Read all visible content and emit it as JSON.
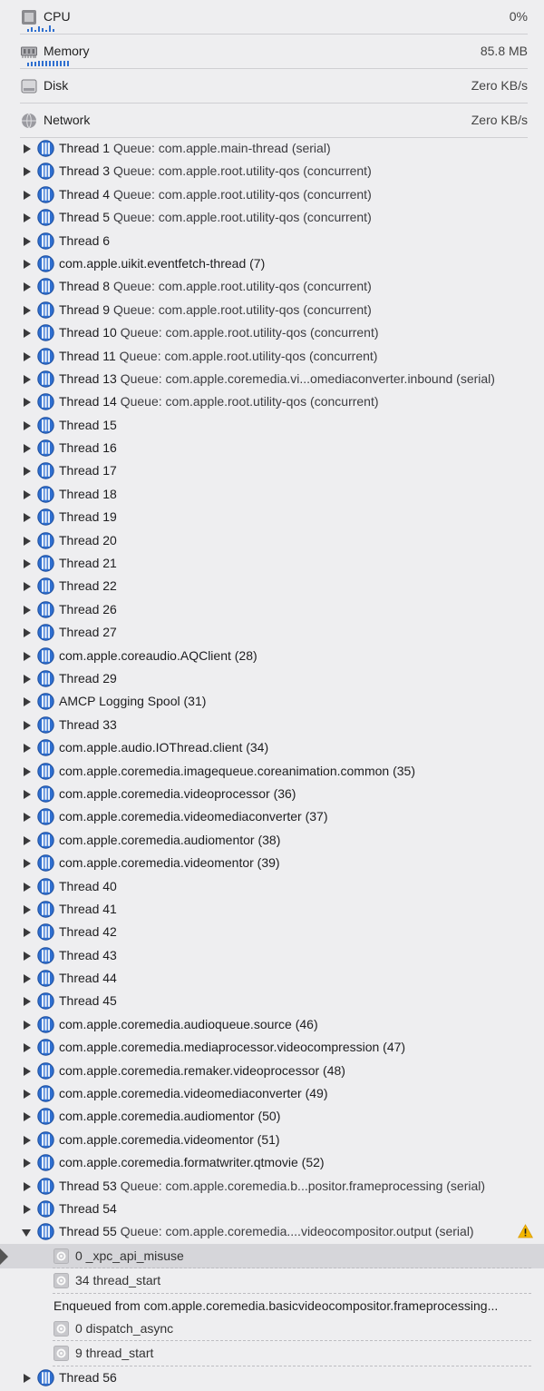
{
  "gauges": [
    {
      "label": "CPU",
      "value": "0%",
      "icon": "cpu-icon"
    },
    {
      "label": "Memory",
      "value": "85.8 MB",
      "icon": "memory-icon"
    },
    {
      "label": "Disk",
      "value": "Zero KB/s",
      "icon": "disk-icon"
    },
    {
      "label": "Network",
      "value": "Zero KB/s",
      "icon": "network-icon"
    }
  ],
  "threads_before": [
    {
      "name": "Thread 1",
      "queue": "Queue: com.apple.main-thread (serial)"
    },
    {
      "name": "Thread 3",
      "queue": "Queue: com.apple.root.utility-qos (concurrent)"
    },
    {
      "name": "Thread 4",
      "queue": "Queue: com.apple.root.utility-qos (concurrent)"
    },
    {
      "name": "Thread 5",
      "queue": "Queue: com.apple.root.utility-qos (concurrent)"
    },
    {
      "name": "Thread 6",
      "queue": ""
    },
    {
      "name": "com.apple.uikit.eventfetch-thread (7)",
      "queue": ""
    },
    {
      "name": "Thread 8",
      "queue": "Queue: com.apple.root.utility-qos (concurrent)"
    },
    {
      "name": "Thread 9",
      "queue": "Queue: com.apple.root.utility-qos (concurrent)"
    },
    {
      "name": "Thread 10",
      "queue": "Queue: com.apple.root.utility-qos (concurrent)"
    },
    {
      "name": "Thread 11",
      "queue": "Queue: com.apple.root.utility-qos (concurrent)"
    },
    {
      "name": "Thread 13",
      "queue": "Queue: com.apple.coremedia.vi...omediaconverter.inbound (serial)"
    },
    {
      "name": "Thread 14",
      "queue": "Queue: com.apple.root.utility-qos (concurrent)"
    },
    {
      "name": "Thread 15",
      "queue": ""
    },
    {
      "name": "Thread 16",
      "queue": ""
    },
    {
      "name": "Thread 17",
      "queue": ""
    },
    {
      "name": "Thread 18",
      "queue": ""
    },
    {
      "name": "Thread 19",
      "queue": ""
    },
    {
      "name": "Thread 20",
      "queue": ""
    },
    {
      "name": "Thread 21",
      "queue": ""
    },
    {
      "name": "Thread 22",
      "queue": ""
    },
    {
      "name": "Thread 26",
      "queue": ""
    },
    {
      "name": "Thread 27",
      "queue": ""
    },
    {
      "name": "com.apple.coreaudio.AQClient (28)",
      "queue": ""
    },
    {
      "name": "Thread 29",
      "queue": ""
    },
    {
      "name": "AMCP Logging Spool (31)",
      "queue": ""
    },
    {
      "name": "Thread 33",
      "queue": ""
    },
    {
      "name": "com.apple.audio.IOThread.client (34)",
      "queue": ""
    },
    {
      "name": "com.apple.coremedia.imagequeue.coreanimation.common (35)",
      "queue": ""
    },
    {
      "name": "com.apple.coremedia.videoprocessor (36)",
      "queue": ""
    },
    {
      "name": "com.apple.coremedia.videomediaconverter (37)",
      "queue": ""
    },
    {
      "name": "com.apple.coremedia.audiomentor (38)",
      "queue": ""
    },
    {
      "name": "com.apple.coremedia.videomentor (39)",
      "queue": ""
    },
    {
      "name": "Thread 40",
      "queue": ""
    },
    {
      "name": "Thread 41",
      "queue": ""
    },
    {
      "name": "Thread 42",
      "queue": ""
    },
    {
      "name": "Thread 43",
      "queue": ""
    },
    {
      "name": "Thread 44",
      "queue": ""
    },
    {
      "name": "Thread 45",
      "queue": ""
    },
    {
      "name": "com.apple.coremedia.audioqueue.source (46)",
      "queue": ""
    },
    {
      "name": "com.apple.coremedia.mediaprocessor.videocompression (47)",
      "queue": ""
    },
    {
      "name": "com.apple.coremedia.remaker.videoprocessor (48)",
      "queue": ""
    },
    {
      "name": "com.apple.coremedia.videomediaconverter (49)",
      "queue": ""
    },
    {
      "name": "com.apple.coremedia.audiomentor (50)",
      "queue": ""
    },
    {
      "name": "com.apple.coremedia.videomentor (51)",
      "queue": ""
    },
    {
      "name": "com.apple.coremedia.formatwriter.qtmovie (52)",
      "queue": ""
    },
    {
      "name": "Thread 53",
      "queue": "Queue: com.apple.coremedia.b...positor.frameprocessing (serial)"
    },
    {
      "name": "Thread 54",
      "queue": ""
    }
  ],
  "expanded_thread": {
    "name": "Thread 55",
    "queue": "Queue: com.apple.coremedia....videocompositor.output (serial)",
    "warning_icon": "warning-icon"
  },
  "frames_top": [
    {
      "label": "0 _xpc_api_misuse",
      "selected": true
    },
    {
      "label": "34 thread_start",
      "selected": false
    }
  ],
  "enqueued_text": "Enqueued from com.apple.coremedia.basicvideocompositor.frameprocessing...",
  "frames_bottom": [
    {
      "label": "0 dispatch_async",
      "selected": false
    },
    {
      "label": "9 thread_start",
      "selected": false
    }
  ],
  "threads_after": [
    {
      "name": "Thread 56",
      "queue": ""
    }
  ],
  "colors": {
    "accent": "#2f6fd0",
    "background": "#eeeef0",
    "warning": "#f5b800"
  }
}
